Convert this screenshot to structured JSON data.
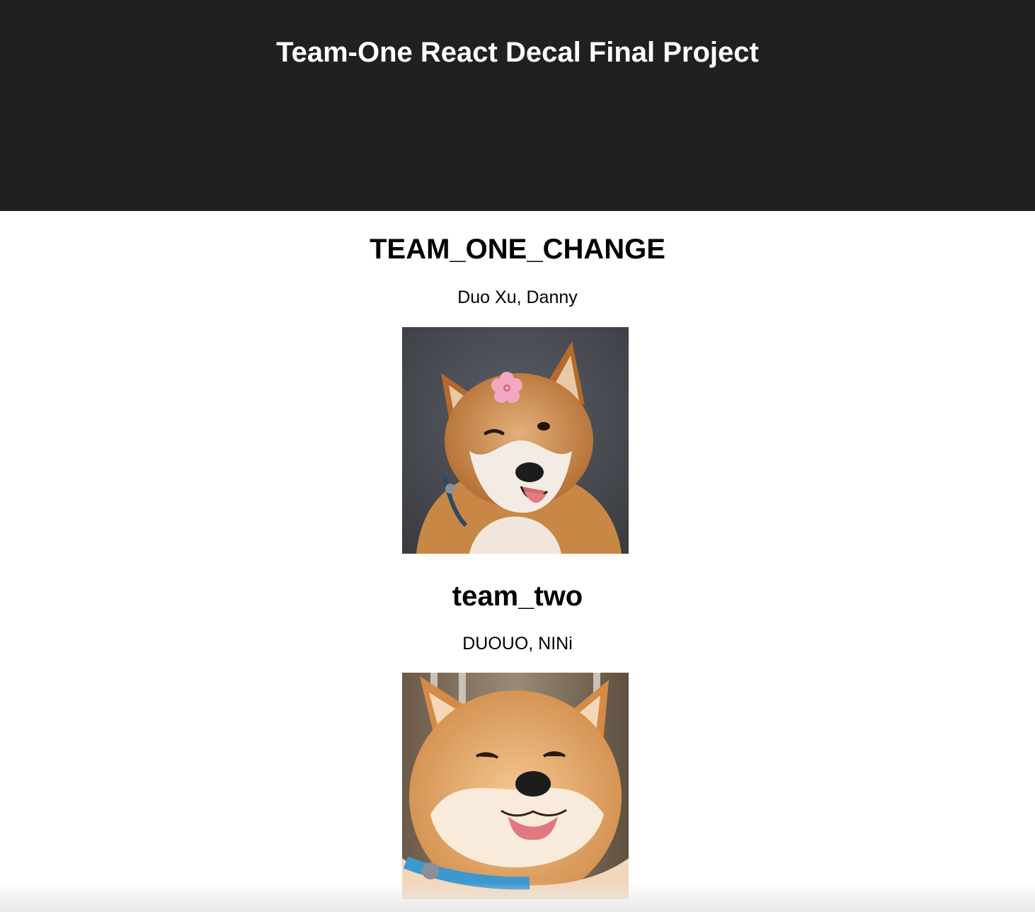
{
  "header": {
    "title": "Team-One React Decal Final Project"
  },
  "teams": [
    {
      "name": "TEAM_ONE_CHANGE",
      "members": "Duo Xu, Danny",
      "photo": "shiba-inu-with-flower-photo"
    },
    {
      "name": "team_two",
      "members": "DUOUO, NINi",
      "photo": "shiba-inu-tongue-out-photo"
    }
  ],
  "colors": {
    "header_bg": "#202020",
    "header_text": "#ffffff",
    "body_text": "#000000",
    "page_bg": "#ffffff"
  }
}
